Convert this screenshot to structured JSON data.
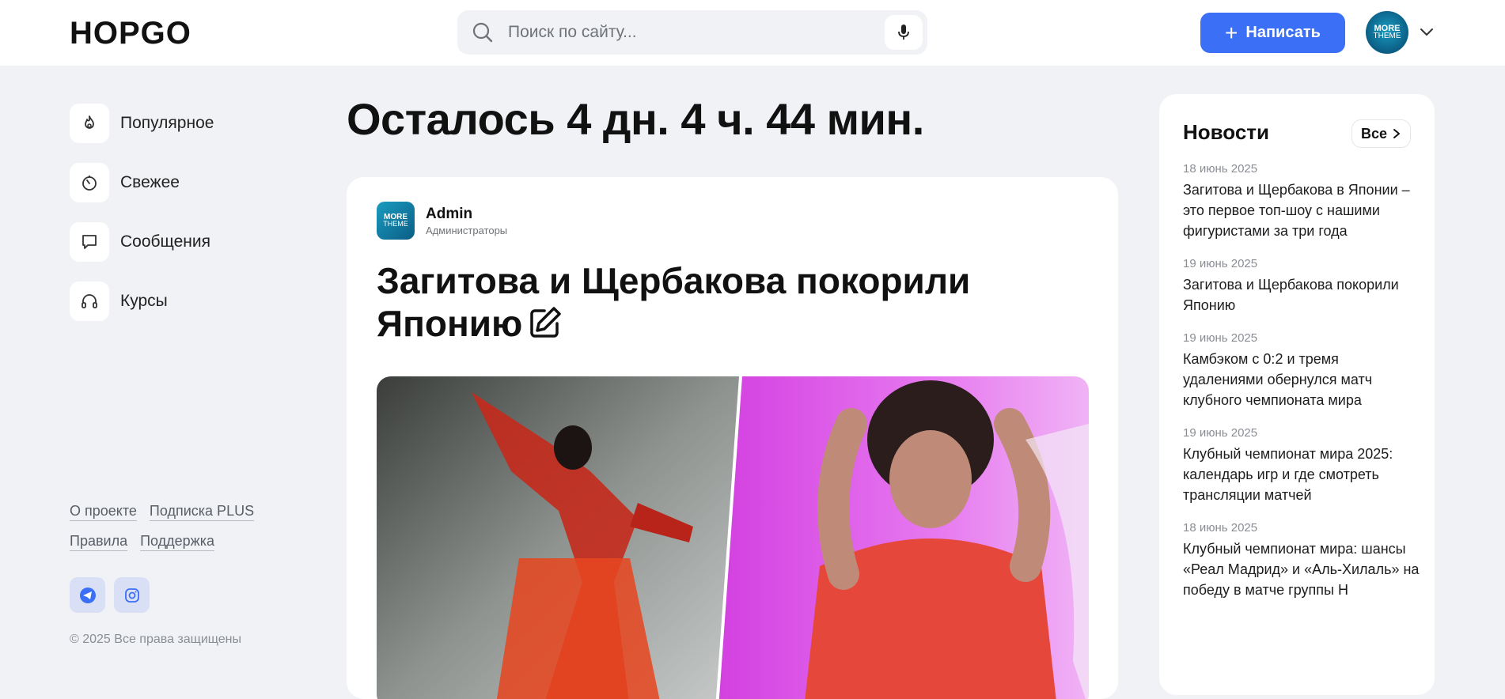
{
  "header": {
    "logo": "HOPGO",
    "search_placeholder": "Поиск по сайту...",
    "write_label": "Написать",
    "avatar_text_1": "MORE",
    "avatar_text_2": "THEME"
  },
  "sidebar": {
    "items": [
      {
        "label": "Популярное",
        "icon": "fire-icon"
      },
      {
        "label": "Свежее",
        "icon": "timer-icon"
      },
      {
        "label": "Сообщения",
        "icon": "message-icon"
      },
      {
        "label": "Курсы",
        "icon": "headphones-icon"
      }
    ],
    "footer_links": [
      "О проекте",
      "Подписка PLUS",
      "Правила",
      "Поддержка"
    ],
    "social": [
      "telegram-icon",
      "instagram-icon"
    ],
    "copyright": "© 2025 Все права защищены"
  },
  "main": {
    "countdown": "Осталось 4 дн. 4 ч. 44 мин.",
    "post": {
      "author_name": "Admin",
      "author_role": "Администраторы",
      "title": "Загитова и Щербакова покорили Японию"
    }
  },
  "news": {
    "title": "Новости",
    "all_label": "Все",
    "items": [
      {
        "date": "18 июнь 2025",
        "text": "Загитова и Щербакова в Японии – это первое топ-шоу с нашими фигуристами за три года"
      },
      {
        "date": "19 июнь 2025",
        "text": "Загитова и Щербакова покорили Японию"
      },
      {
        "date": "19 июнь 2025",
        "text": "Камбэком с 0:2 и тремя удалениями обернулся матч клубного чемпионата мира"
      },
      {
        "date": "19 июнь 2025",
        "text": "Клубный чемпионат мира 2025: календарь игр и где смотреть трансляции матчей"
      },
      {
        "date": "18 июнь 2025",
        "text": "Клубный чемпионат мира: шансы «Реал Мадрид» и «Аль-Хилаль» на победу в матче группы H"
      }
    ]
  },
  "colors": {
    "accent": "#3b6ff5",
    "background": "#f0f2f5"
  }
}
